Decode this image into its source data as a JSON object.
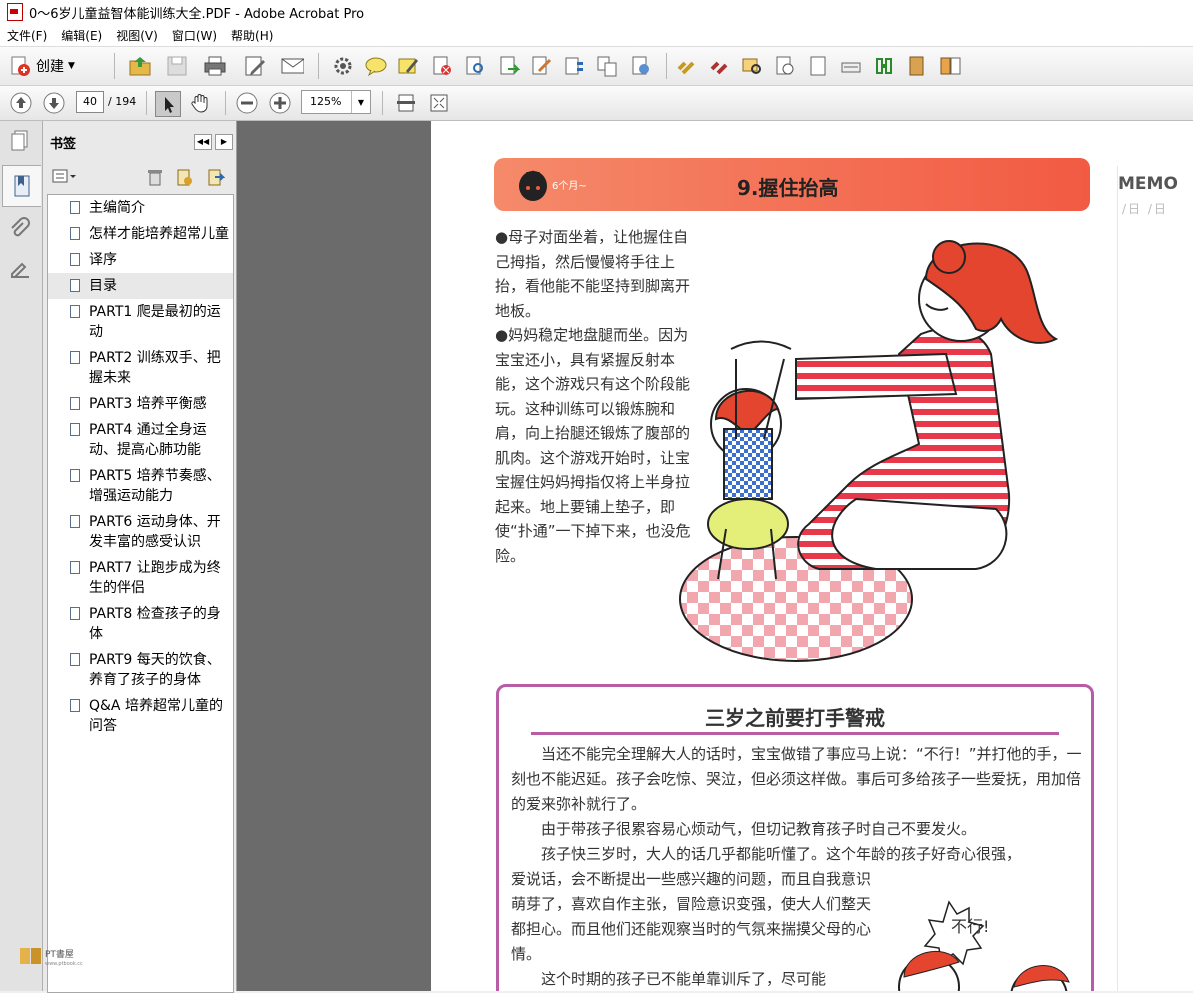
{
  "window": {
    "title": "0～6岁儿童益智体能训练大全.PDF - Adobe Acrobat Pro"
  },
  "menubar": {
    "items": [
      "文件(F)",
      "编辑(E)",
      "视图(V)",
      "窗口(W)",
      "帮助(H)"
    ]
  },
  "toolbar": {
    "create_label": "创建",
    "current_page": "40",
    "total_pages": "/ 194",
    "zoom": "125%"
  },
  "sidebar": {
    "title": "书签",
    "bookmarks": [
      {
        "label": "主编简介"
      },
      {
        "label": "怎样才能培养超常儿童"
      },
      {
        "label": "译序"
      },
      {
        "label": "目录",
        "selected": true
      },
      {
        "label": "PART1 爬是最初的运动"
      },
      {
        "label": "PART2 训练双手、把握未来"
      },
      {
        "label": "PART3 培养平衡感"
      },
      {
        "label": "PART4 通过全身运动、提高心肺功能"
      },
      {
        "label": "PART5 培养节奏感、增强运动能力"
      },
      {
        "label": "PART6 运动身体、开发丰富的感受认识"
      },
      {
        "label": "PART7 让跑步成为终生的伴侣"
      },
      {
        "label": "PART8 检查孩子的身体"
      },
      {
        "label": "PART9 每天的饮食、养育了孩子的身体"
      },
      {
        "label": "Q&A 培养超常儿童的问答"
      }
    ]
  },
  "document": {
    "memo_label": "MEMO",
    "memo_sub": "/日 /日",
    "banner_age": "6个月~",
    "banner_title": "9.握住抬高",
    "paragraphs": [
      "●母子对面坐着，让他握住自己拇指，然后慢慢将手往上抬，看他能不能坚持到脚离开地板。",
      "●妈妈稳定地盘腿而坐。因为宝宝还小，具有紧握反射本能，这个游戏只有这个阶段能玩。这种训练可以锻炼腕和肩，向上抬腿还锻炼了腹部的肌肉。这个游戏开始时，让宝宝握住妈妈拇指仅将上半身拉起来。地上要铺上垫子，即使“扑通”一下掉下来，也没危险。"
    ],
    "box_title": "三岁之前要打手警戒",
    "box_paragraphs": [
      "当还不能完全理解大人的话时，宝宝做错了事应马上说：“不行！”并打他的手，一刻也不能迟延。孩子会吃惊、哭泣，但必须这样做。事后可多给孩子一些爱抚，用加倍的爱来弥补就行了。",
      "由于带孩子很累容易心烦动气，但切记教育孩子时自己不要发火。",
      "孩子快三岁时，大人的话几乎都能听懂了。这个年龄的孩子好奇心很强，"
    ],
    "box_narrow_paragraphs": [
      "爱说话，会不断提出一些感兴趣的问题，而且自我意识萌芽了，喜欢自作主张，冒险意识变强，使大人们整天都担心。而且他们还能观察当时的气氛来揣摸父母的心情。",
      "这个时期的孩子已不能单靠训斥了，尽可能"
    ],
    "speech_bubble": "不行!"
  },
  "colors": {
    "banner": "#f25a43",
    "box_border": "#b85ca8",
    "gray_bg": "#6b6b6b"
  }
}
